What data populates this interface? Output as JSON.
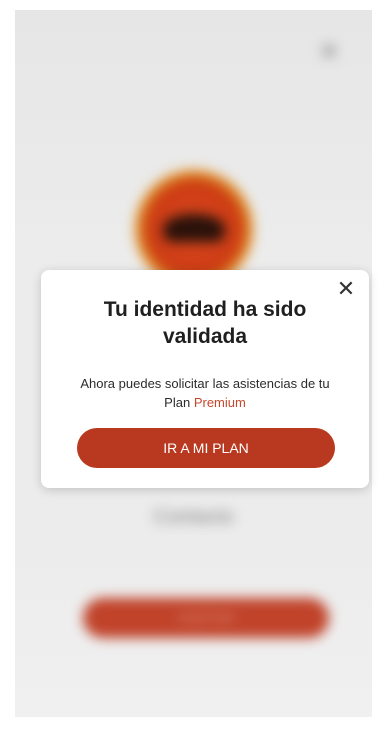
{
  "background": {
    "close_icon": "close-icon",
    "contact_label": "Contacto",
    "button_label": "ACEPTAR"
  },
  "modal": {
    "title": "Tu identidad ha sido validada",
    "message_prefix": "Ahora puedes solicitar las asistencias de tu Plan",
    "message_highlight": "Premium",
    "button_label": "IR A MI PLAN",
    "close_icon": "close-icon"
  },
  "colors": {
    "accent": "#b8391f",
    "highlight": "#c5472c"
  }
}
